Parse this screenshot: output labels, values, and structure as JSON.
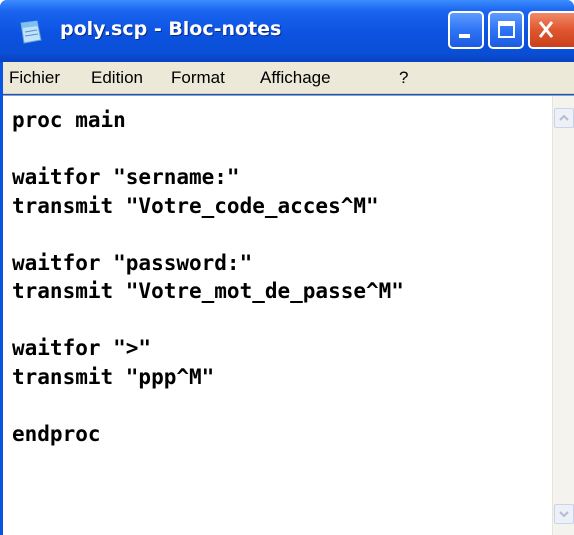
{
  "window": {
    "title": "poly.scp - Bloc-notes",
    "app_icon": "notepad-icon",
    "controls": [
      "minimize-icon",
      "maximize-icon",
      "close-icon"
    ]
  },
  "menu": {
    "items": [
      "Fichier",
      "Edition",
      "Format",
      "Affichage",
      "?"
    ]
  },
  "editor": {
    "content": "proc main\n\nwaitfor \"sername:\"\ntransmit \"Votre_code_acces^M\"\n\nwaitfor \"password:\"\ntransmit \"Votre_mot_de_passe^M\"\n\nwaitfor \">\"\ntransmit \"ppp^M\"\n\nendproc"
  },
  "colors": {
    "titlebar": "#0a54e4",
    "close_button": "#e0562f",
    "menubar": "#ece9d8"
  }
}
